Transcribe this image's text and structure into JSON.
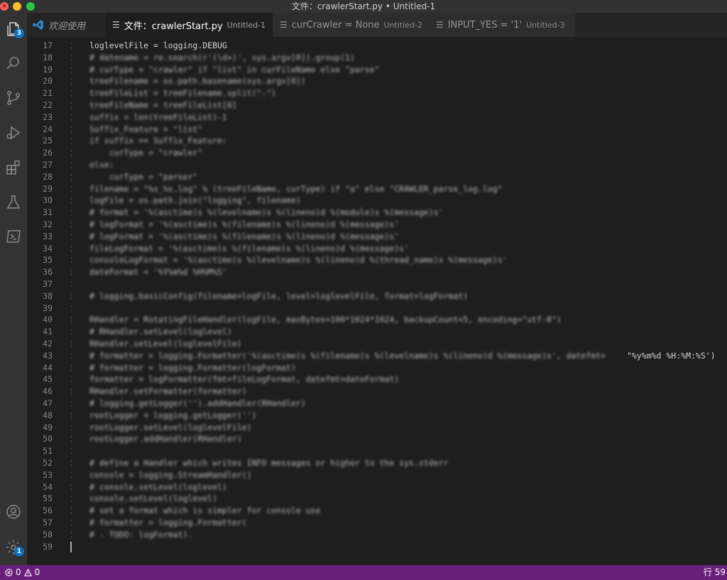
{
  "window": {
    "title": "文件：crawlerStart.py • Untitled-1"
  },
  "activity_bar": {
    "items": [
      {
        "icon": "files-icon",
        "badge": "3"
      },
      {
        "icon": "search-icon"
      },
      {
        "icon": "source-control-icon"
      },
      {
        "icon": "run-debug-icon"
      },
      {
        "icon": "extensions-icon"
      },
      {
        "icon": "testing-icon"
      },
      {
        "icon": "terminal-icon"
      }
    ],
    "account_icon": "account-icon",
    "settings_badge": "1"
  },
  "tabs": [
    {
      "label": "欢迎使用",
      "desc": "",
      "active": false
    },
    {
      "label": "文件：crawlerStart.py",
      "desc": "Untitled-1",
      "active": true
    },
    {
      "label": "curCrawler = None",
      "desc": "Untitled-2",
      "active": false
    },
    {
      "label": "INPUT_YES = '1'",
      "desc": "Untitled-3",
      "active": false
    }
  ],
  "editor": {
    "lines": [
      {
        "n": "17",
        "text": "loglevelFile = logging.DEBUG",
        "blur": false,
        "indent": 1
      },
      {
        "n": "18",
        "text": "# datename = re.search(r'(\\d+)', sys.argv[0]).group(1)",
        "blur": true,
        "indent": 1
      },
      {
        "n": "19",
        "text": "# curType = \"crawler\" if \"list\" in curFileName else \"parse\"",
        "blur": true,
        "indent": 1
      },
      {
        "n": "20",
        "text": "treeFilename = os.path.basename(sys.argv[0])",
        "blur": true,
        "indent": 1
      },
      {
        "n": "21",
        "text": "treeFileList = treeFilename.split(\".\")",
        "blur": true,
        "indent": 1
      },
      {
        "n": "22",
        "text": "treeFileName = treeFileList[0]",
        "blur": true,
        "indent": 1
      },
      {
        "n": "23",
        "text": "suffix = len(treeFileList)-1",
        "blur": true,
        "indent": 1
      },
      {
        "n": "24",
        "text": "Suffix_Feature = \"list\"",
        "blur": true,
        "indent": 1
      },
      {
        "n": "25",
        "text": "if suffix == Suffix_Feature:",
        "blur": true,
        "indent": 1
      },
      {
        "n": "26",
        "text": "    curType = \"crawler\"",
        "blur": true,
        "indent": 2
      },
      {
        "n": "27",
        "text": "else:",
        "blur": true,
        "indent": 1
      },
      {
        "n": "28",
        "text": "    curType = \"parser\"",
        "blur": true,
        "indent": 2
      },
      {
        "n": "29",
        "text": "filename = \"%s_%s.log\" % (treeFileName, curType) if \"a\" else \"CRAWLER_parse_log.log\"",
        "blur": true,
        "indent": 1
      },
      {
        "n": "30",
        "text": "logFile = os.path.join(\"logging\", filename)",
        "blur": true,
        "indent": 1
      },
      {
        "n": "31",
        "text": "# format = '%(asctime)s %(levelname)s %(lineno)d %(module)s %(message)s'",
        "blur": true,
        "indent": 1
      },
      {
        "n": "32",
        "text": "# logFormat = '%(asctime)s %(filename)s %(lineno)d %(message)s'",
        "blur": true,
        "indent": 1
      },
      {
        "n": "33",
        "text": "# logFormat = '%(asctime)s %(filename)s %(lineno)d %(message)s'",
        "blur": true,
        "indent": 1
      },
      {
        "n": "34",
        "text": "fileLogFormat = '%(asctime)s %(filename)s %(lineno)d %(message)s'",
        "blur": true,
        "indent": 1
      },
      {
        "n": "35",
        "text": "consoleLogFormat = '%(asctime)s %(levelname)s %(lineno)d %(thread_name)s %(message)s'",
        "blur": true,
        "indent": 1
      },
      {
        "n": "36",
        "text": "dateFormat = '%Y%m%d %H%M%S'",
        "blur": true,
        "indent": 1
      },
      {
        "n": "37",
        "text": "",
        "blur": false,
        "indent": 1
      },
      {
        "n": "38",
        "text": "# logging.basicConfig(filename=logFile, level=loglevelFile, format=logFormat)",
        "blur": true,
        "indent": 1
      },
      {
        "n": "39",
        "text": "",
        "blur": false,
        "indent": 1
      },
      {
        "n": "40",
        "text": "RHandler = RotatingFileHandler(logFile, maxBytes=100*1024*1024, backupCount=5, encoding=\"utf-8\")",
        "blur": true,
        "indent": 1
      },
      {
        "n": "41",
        "text": "# RHandler.setLevel(loglevel)",
        "blur": true,
        "indent": 1
      },
      {
        "n": "42",
        "text": "RHandler.setLevel(loglevelFile)",
        "blur": true,
        "indent": 1
      },
      {
        "n": "43",
        "text": "# formatter = logging.Formatter('%(asctime)s %(filename)s %(levelname)s %(lineno)d %(message)s', datefmt=",
        "blur": true,
        "indent": 1,
        "suffix": "\"%y%m%d %H:%M:%S')"
      },
      {
        "n": "44",
        "text": "# formatter = logging.Formatter(logFormat)",
        "blur": true,
        "indent": 1
      },
      {
        "n": "45",
        "text": "formatter = logFormatter(fmt=fileLogFormat, datefmt=dateFormat)",
        "blur": true,
        "indent": 1
      },
      {
        "n": "46",
        "text": "RHandler.setFormatter(formatter)",
        "blur": true,
        "indent": 1
      },
      {
        "n": "47",
        "text": "# logging.getLogger('').addHandler(RHandler)",
        "blur": true,
        "indent": 1
      },
      {
        "n": "48",
        "text": "rootLogger = logging.getLogger('')",
        "blur": true,
        "indent": 1
      },
      {
        "n": "49",
        "text": "rootLogger.setLevel(loglevelFile)",
        "blur": true,
        "indent": 1
      },
      {
        "n": "50",
        "text": "rootLogger.addHandler(RHandler)",
        "blur": true,
        "indent": 1
      },
      {
        "n": "51",
        "text": "",
        "blur": false,
        "indent": 1
      },
      {
        "n": "52",
        "text": "# define a Handler which writes INFO messages or higher to the sys.stderr",
        "blur": true,
        "indent": 1
      },
      {
        "n": "53",
        "text": "console = logging.StreamHandler()",
        "blur": true,
        "indent": 1
      },
      {
        "n": "54",
        "text": "# console.setLevel(loglevel)",
        "blur": true,
        "indent": 1
      },
      {
        "n": "55",
        "text": "console.setLevel(loglevel)",
        "blur": true,
        "indent": 1
      },
      {
        "n": "56",
        "text": "# set a format which is simpler for console use",
        "blur": true,
        "indent": 1
      },
      {
        "n": "57",
        "text": "# formatter = logging.Formatter(",
        "blur": true,
        "indent": 1
      },
      {
        "n": "58",
        "text": "# - TODO: logFormat).",
        "blur": true,
        "indent": 1
      },
      {
        "n": "59",
        "text": "",
        "blur": false,
        "indent": 0,
        "cursor": true
      }
    ]
  },
  "status": {
    "errors": "0",
    "warnings": "0",
    "position": "行 59"
  }
}
